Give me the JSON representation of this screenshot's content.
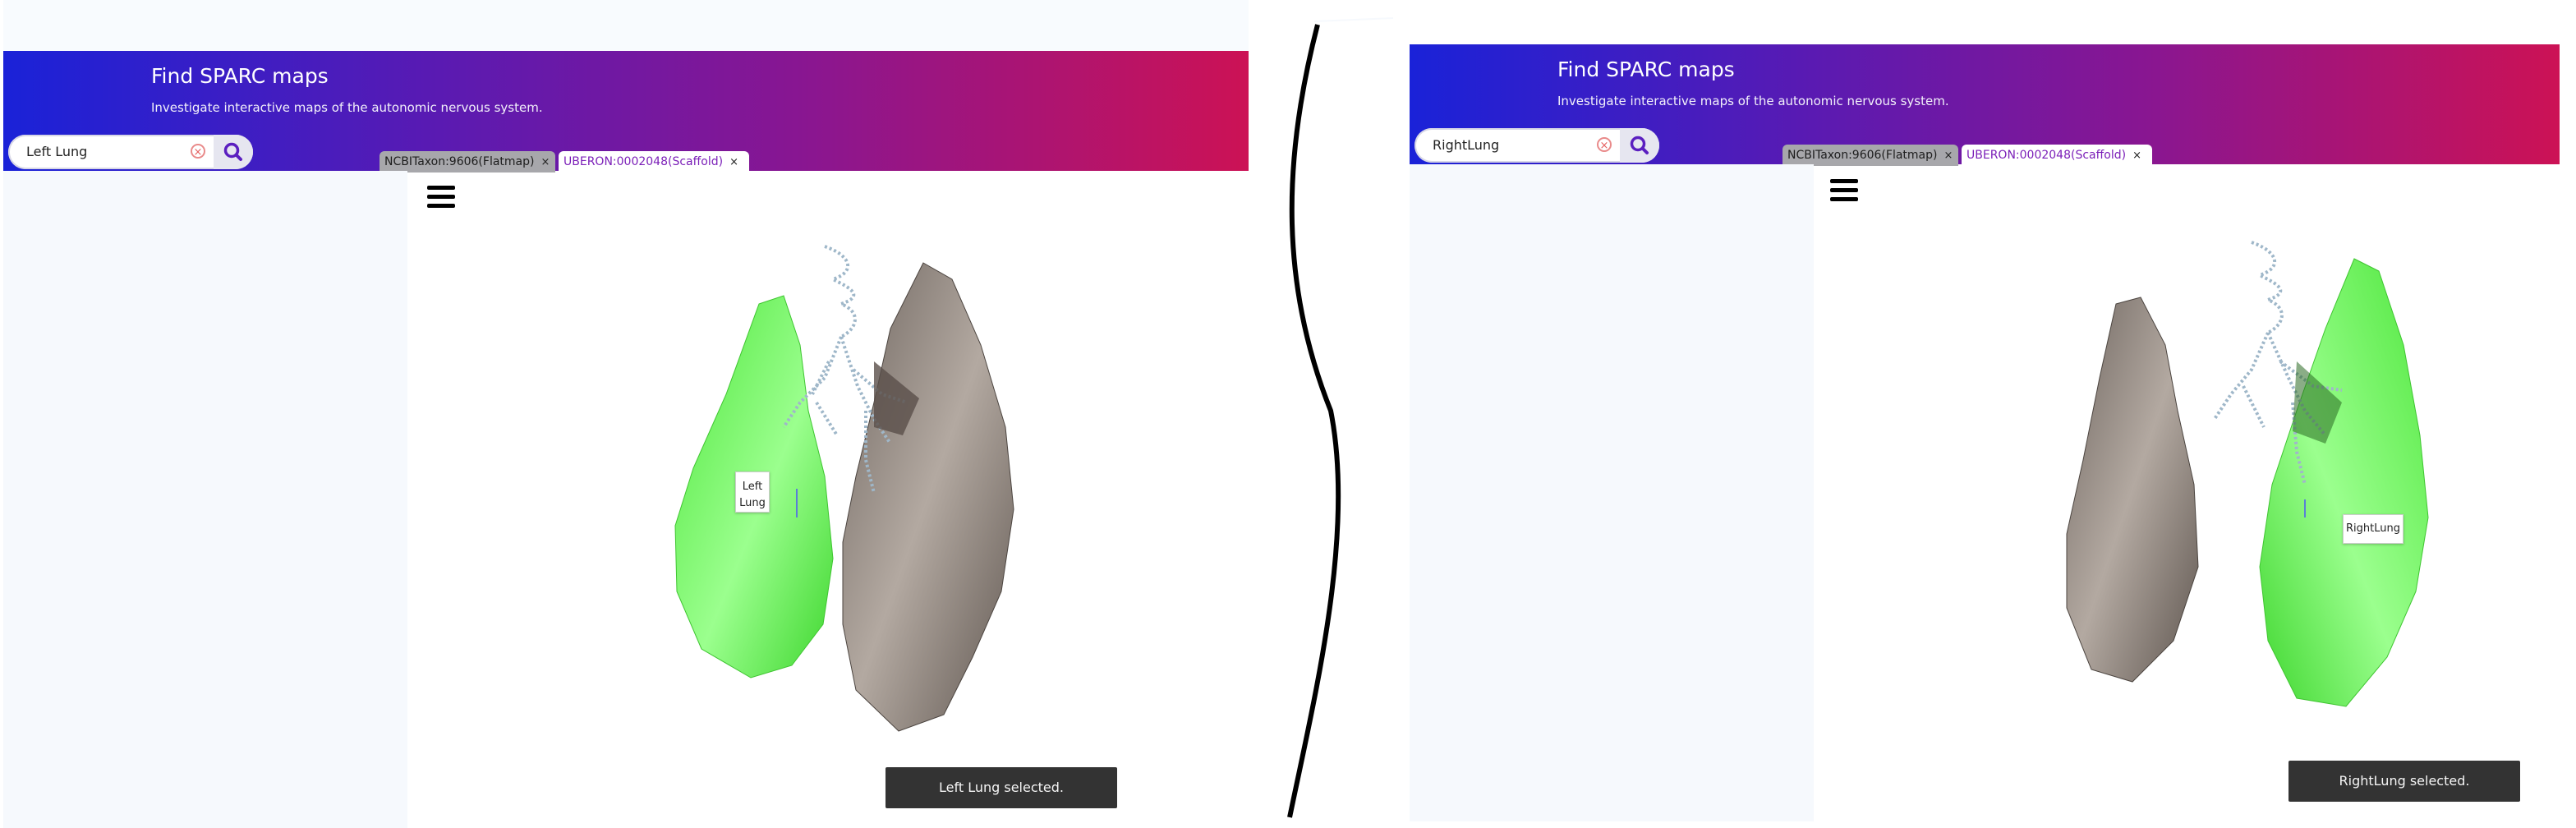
{
  "left": {
    "header": {
      "title": "Find SPARC maps",
      "subtitle": "Investigate interactive maps of the autonomic nervous system."
    },
    "search": {
      "value": "Left Lung"
    },
    "tabs": [
      {
        "label": "NCBITaxon:9606(Flatmap)",
        "active": false
      },
      {
        "label": "UBERON:0002048(Scaffold)",
        "active": true
      }
    ],
    "scene": {
      "label_lines": [
        "Left",
        "Lung"
      ],
      "highlighted": "left lung"
    },
    "toast": "Left Lung selected."
  },
  "right": {
    "header": {
      "title": "Find SPARC maps",
      "subtitle": "Investigate interactive maps of the autonomic nervous system."
    },
    "search": {
      "value": "RightLung"
    },
    "tabs": [
      {
        "label": "NCBITaxon:9606(Flatmap)",
        "active": false
      },
      {
        "label": "UBERON:0002048(Scaffold)",
        "active": true
      }
    ],
    "scene": {
      "label_lines": [
        "RightLung"
      ],
      "highlighted": "right lung"
    },
    "toast": "RightLung selected."
  },
  "tab_close_symbol": "×",
  "colors": {
    "header_gradient": [
      "#1a22d8",
      "#5a1ab2",
      "#8a1690",
      "#cc1255"
    ],
    "selected_lung": "#5df04f",
    "unselected_lung": "#8b817a",
    "airways": "#9fb7c9",
    "active_tab_text": "#7b1fb8",
    "toast_bg": "#333333"
  }
}
